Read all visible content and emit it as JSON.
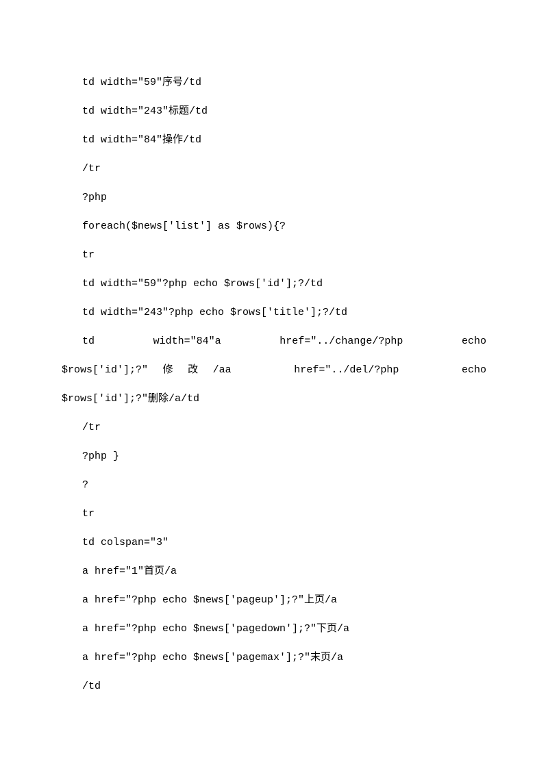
{
  "lines": [
    {
      "text": "td width=\"59\"序号/td",
      "class": "line"
    },
    {
      "text": "td width=\"243\"标题/td",
      "class": "line"
    },
    {
      "text": "td width=\"84\"操作/td",
      "class": "line"
    },
    {
      "text": "/tr",
      "class": "line"
    },
    {
      "text": "?php",
      "class": "line"
    },
    {
      "text": "foreach($news['list'] as $rows){?",
      "class": "line"
    },
    {
      "text": "tr",
      "class": "line"
    },
    {
      "text": "td width=\"59\"?php echo $rows['id'];?/td",
      "class": "line"
    },
    {
      "text": "td width=\"243\"?php echo $rows['title'];?/td",
      "class": "line"
    },
    {
      "text": "td   width=\"84\"a   href=\"../change/?php   echo",
      "class": "line justify"
    },
    {
      "text": "$rows['id'];?\"修改/aa   href=\"../del/?php   echo",
      "class": "line justify noindent"
    },
    {
      "text": "$rows['id'];?\"删除/a/td",
      "class": "line noindent"
    },
    {
      "text": "/tr",
      "class": "line"
    },
    {
      "text": "?php }",
      "class": "line"
    },
    {
      "text": "?",
      "class": "line"
    },
    {
      "text": "tr",
      "class": "line"
    },
    {
      "text": "td colspan=\"3\"",
      "class": "line"
    },
    {
      "text": "a href=\"1\"首页/a",
      "class": "line"
    },
    {
      "text": "a href=\"?php echo $news['pageup'];?\"上页/a",
      "class": "line"
    },
    {
      "text": "a href=\"?php echo $news['pagedown'];?\"下页/a",
      "class": "line"
    },
    {
      "text": "a href=\"?php echo $news['pagemax'];?\"末页/a",
      "class": "line"
    },
    {
      "text": "/td",
      "class": "line"
    }
  ]
}
